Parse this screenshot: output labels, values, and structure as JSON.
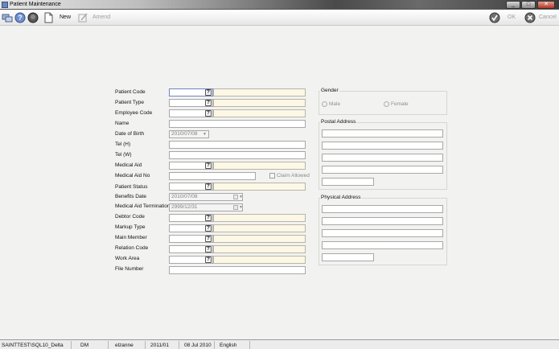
{
  "window": {
    "title": "Patient Maintenance"
  },
  "toolbar": {
    "new_label": "New",
    "amend_label": "Amend",
    "ok_label": "OK",
    "cancel_label": "Cancel"
  },
  "form": {
    "patient_code": {
      "label": "Patient Code",
      "value": ""
    },
    "patient_type": {
      "label": "Patient Type",
      "value": ""
    },
    "employee_code": {
      "label": "Employee Code",
      "value": ""
    },
    "name": {
      "label": "Name",
      "value": ""
    },
    "date_of_birth": {
      "label": "Date of Birth",
      "value": "2010/07/08"
    },
    "tel_h": {
      "label": "Tel (H)",
      "value": ""
    },
    "tel_w": {
      "label": "Tel (W)",
      "value": ""
    },
    "medical_aid": {
      "label": "Medical Aid",
      "value": ""
    },
    "medical_aid_no": {
      "label": "Medical Aid No",
      "value": ""
    },
    "claim_allowed": {
      "label": "Claim Allowed",
      "checked": false
    },
    "patient_status": {
      "label": "Patient Status",
      "value": ""
    },
    "benefits_date": {
      "label": "Benefits Date",
      "value": "2010/07/08"
    },
    "medical_aid_termination": {
      "label": "Medical Aid Termination",
      "value": "2999/12/31"
    },
    "debtor_code": {
      "label": "Debtor Code",
      "value": ""
    },
    "markup_type": {
      "label": "Markup Type",
      "value": ""
    },
    "main_member": {
      "label": "Main Member",
      "value": ""
    },
    "relation_code": {
      "label": "Relation Code",
      "value": ""
    },
    "work_area": {
      "label": "Work Area",
      "value": ""
    },
    "file_number": {
      "label": "File Number",
      "value": ""
    },
    "lookup_glyph": "?"
  },
  "gender": {
    "title": "Gender",
    "options": [
      "Male",
      "Female"
    ],
    "selected": null
  },
  "postal_address": {
    "title": "Postal Address",
    "lines": [
      "",
      "",
      "",
      "",
      ""
    ],
    "postal_code": ""
  },
  "physical_address": {
    "title": "Physical Address",
    "lines": [
      "",
      "",
      "",
      "",
      ""
    ],
    "postal_code": ""
  },
  "statusbar": {
    "server": "SAINTTEST\\SQL10_Delta",
    "initials": "DM",
    "user": "elzanne",
    "period": "2011/01",
    "date": "08 Jul 2010",
    "language": "English"
  },
  "colors": {
    "required_field_bg": "#fdf7e6",
    "window_bg": "#f2f2f0"
  }
}
